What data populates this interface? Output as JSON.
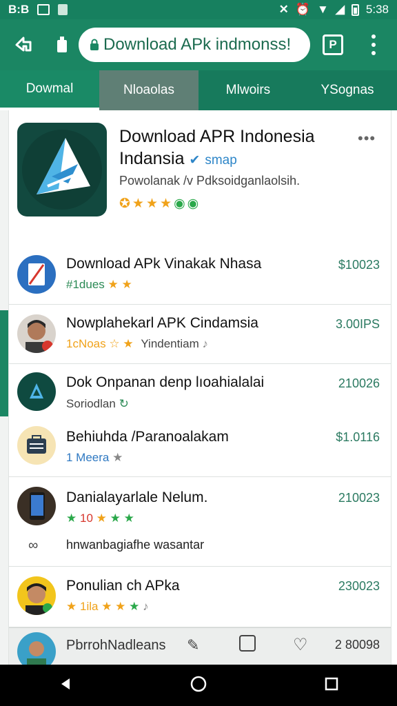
{
  "status_bar": {
    "left_label": "B:B",
    "time": "5:38"
  },
  "toolbar": {
    "url_text": "Download APk indmonss!",
    "tabs_count": "P"
  },
  "nav_tabs": [
    {
      "label": "Dowmal"
    },
    {
      "label": "Nloaolas"
    },
    {
      "label": "Mlwoirs"
    },
    {
      "label": "YSognas"
    }
  ],
  "hero": {
    "title_line1": "Download APR Indonesia",
    "title_line2": "Indansia",
    "verified_label": "smap",
    "subtitle": "Powolanak /v Pdksoidganlaolsih.",
    "icon_name": "download-arrow-app-icon"
  },
  "list": [
    {
      "title": "Download APk Vinakak Nhasa",
      "sub": "#1dues",
      "price": "$10023"
    },
    {
      "title": "Nowplahekarl APK Cindamsia",
      "sub_a": "1cNoas",
      "sub_b": "Yindentiam",
      "price": "3.00IPS"
    },
    {
      "title": "Dok Onpanan denp lıoahialalai",
      "sub": "Soriodlan",
      "price": "210026"
    },
    {
      "title": "Behiuhda /Paranoalakam",
      "sub": "1 Meera",
      "price": "$1.0116"
    },
    {
      "title": "Danialayarlale Nelum.",
      "sub": "10",
      "price": "210023"
    },
    {
      "title": "hnwanbagiafhe wasantar",
      "sub": "",
      "price": ""
    },
    {
      "title": "Ponulian ch APka",
      "sub": "1ila",
      "price": "230023"
    },
    {
      "title": "PbrrohNadleans",
      "sub": "",
      "price": "2 80098"
    }
  ],
  "colors": {
    "brand_green": "#1b8663",
    "star_orange": "#f0a21a",
    "price_green": "#2b7a61"
  }
}
